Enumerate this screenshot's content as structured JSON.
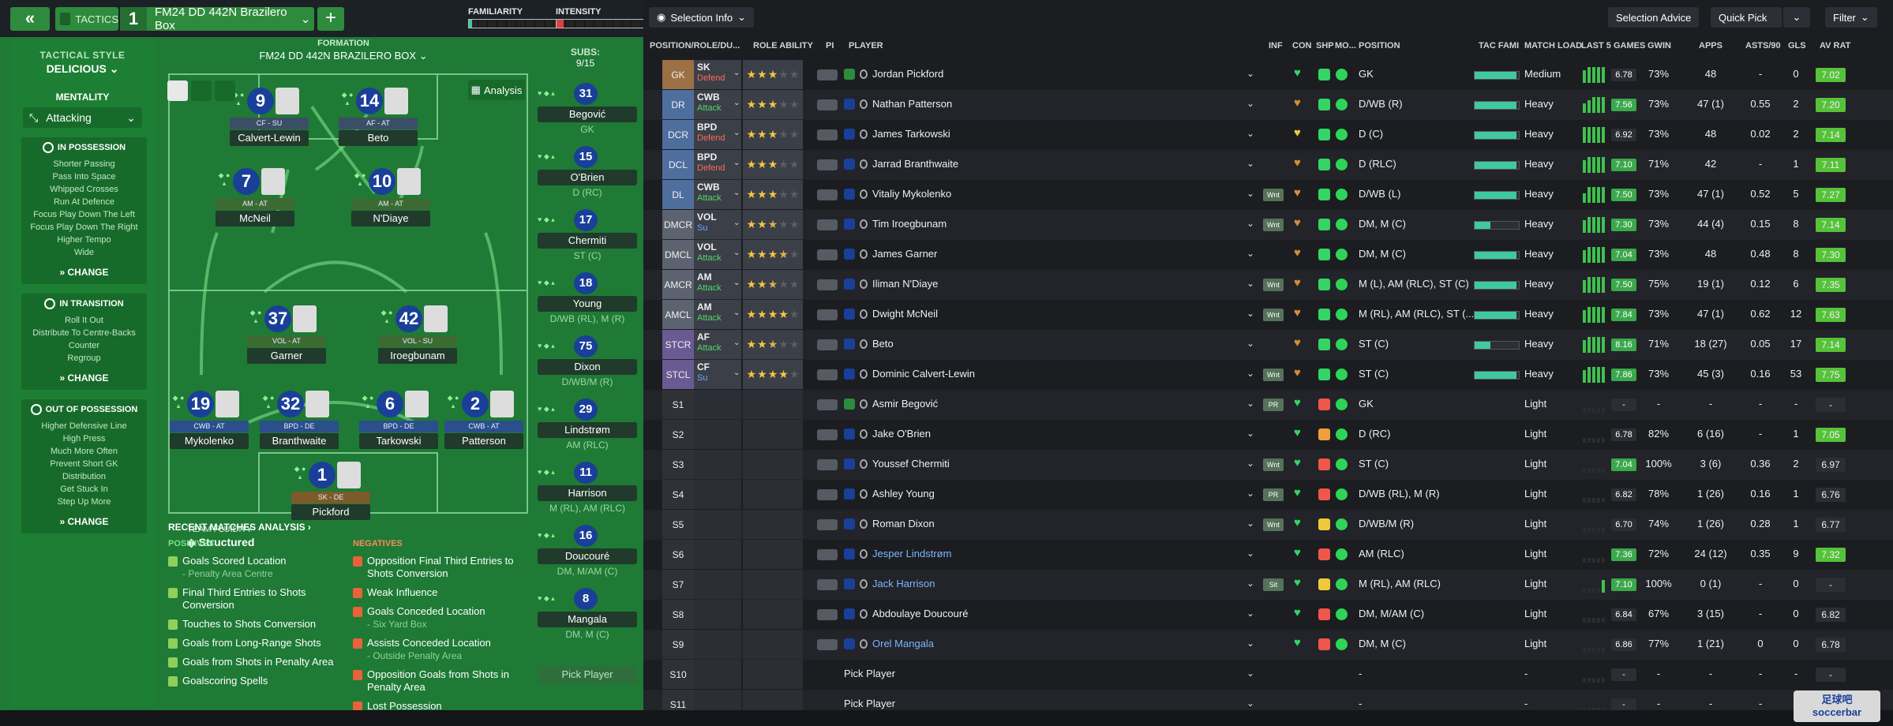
{
  "topbar": {
    "tactics_label": "TACTICS",
    "tactic_number": "1",
    "tactic_name": "FM24 DD 442N Brazilero Box",
    "add_label": "+",
    "familiarity_label": "FAMILIARITY",
    "familiarity_level": 0.03,
    "intensity_label": "INTENSITY",
    "intensity_level": 0.08
  },
  "side": {
    "tactical_style_label": "TACTICAL STYLE",
    "tactical_style_value": "DELICIOUS",
    "mentality_label": "MENTALITY",
    "mentality_value": "Attacking",
    "in_possession": {
      "title": "IN POSSESSION",
      "items": [
        "Shorter Passing",
        "Pass Into Space",
        "Whipped Crosses",
        "Run At Defence",
        "Focus Play Down The Left",
        "Focus Play Down The Right",
        "Higher Tempo",
        "Wide"
      ],
      "change": "CHANGE"
    },
    "in_transition": {
      "title": "IN TRANSITION",
      "items": [
        "Roll It Out",
        "Distribute To Centre-Backs",
        "Counter",
        "Regroup"
      ],
      "change": "CHANGE"
    },
    "out_of_possession": {
      "title": "OUT OF POSSESSION",
      "items": [
        "Higher Defensive Line",
        "High Press",
        "Much More Often",
        "Prevent Short GK",
        "Distribution",
        "Get Stuck In",
        "Step Up More"
      ],
      "change": "CHANGE"
    }
  },
  "pitch": {
    "formation_label": "FORMATION",
    "formation_name": "FM24 DD 442N BRAZILERO BOX",
    "analysis_label": "Analysis",
    "team_fluidity_label": "TEAM FLUIDITY",
    "team_fluidity_value": "Structured",
    "players": [
      {
        "num": "9",
        "role": "CF - SU",
        "name": "Calvert-Lewin",
        "cls": ""
      },
      {
        "num": "14",
        "role": "AF - AT",
        "name": "Beto",
        "cls": ""
      },
      {
        "num": "7",
        "role": "AM - AT",
        "name": "McNeil",
        "cls": "mf"
      },
      {
        "num": "10",
        "role": "AM - AT",
        "name": "N'Diaye",
        "cls": "mf"
      },
      {
        "num": "37",
        "role": "VOL - AT",
        "name": "Garner",
        "cls": "mf"
      },
      {
        "num": "42",
        "role": "VOL - SU",
        "name": "Iroegbunam",
        "cls": "mf"
      },
      {
        "num": "19",
        "role": "CWB - AT",
        "name": "Mykolenko",
        "cls": "de"
      },
      {
        "num": "32",
        "role": "BPD - DE",
        "name": "Branthwaite",
        "cls": "de"
      },
      {
        "num": "6",
        "role": "BPD - DE",
        "name": "Tarkowski",
        "cls": "de"
      },
      {
        "num": "2",
        "role": "CWB - AT",
        "name": "Patterson",
        "cls": "de"
      },
      {
        "num": "1",
        "role": "SK - DE",
        "name": "Pickford",
        "cls": "gk"
      }
    ]
  },
  "analysis": {
    "title": "RECENT MATCHES ANALYSIS",
    "positives_label": "POSITIVES",
    "negatives_label": "NEGATIVES",
    "positives": [
      {
        "t": "Goals Scored Location",
        "s": "- Penalty Area Centre"
      },
      {
        "t": "Final Third Entries to Shots Conversion",
        "s": ""
      },
      {
        "t": "Touches to Shots Conversion",
        "s": ""
      },
      {
        "t": "Goals from Long-Range Shots",
        "s": ""
      },
      {
        "t": "Goals from Shots in Penalty Area",
        "s": ""
      },
      {
        "t": "Goalscoring Spells",
        "s": ""
      }
    ],
    "negatives": [
      {
        "t": "Opposition Final Third Entries to Shots Conversion",
        "s": ""
      },
      {
        "t": "Weak Influence",
        "s": ""
      },
      {
        "t": "Goals Conceded Location",
        "s": "- Six Yard Box"
      },
      {
        "t": "Assists Conceded Location",
        "s": "- Outside Penalty Area"
      },
      {
        "t": "Opposition Goals from Shots in Penalty Area",
        "s": ""
      },
      {
        "t": "Lost Possession",
        "s": ""
      }
    ]
  },
  "subs": {
    "label": "SUBS:",
    "count": "9/15",
    "pick_label": "Pick Player",
    "items": [
      {
        "num": "31",
        "name": "Begović",
        "pos": "GK"
      },
      {
        "num": "15",
        "name": "O'Brien",
        "pos": "D (RC)"
      },
      {
        "num": "17",
        "name": "Chermiti",
        "pos": "ST (C)"
      },
      {
        "num": "18",
        "name": "Young",
        "pos": "D/WB (RL), M (R)"
      },
      {
        "num": "75",
        "name": "Dixon",
        "pos": "D/WB/M (R)"
      },
      {
        "num": "29",
        "name": "Lindstrøm",
        "pos": "AM (RLC)"
      },
      {
        "num": "11",
        "name": "Harrison",
        "pos": "M (RL), AM (RLC)"
      },
      {
        "num": "16",
        "name": "Doucouré",
        "pos": "DM, M/AM (C)"
      },
      {
        "num": "8",
        "name": "Mangala",
        "pos": "DM, M (C)"
      }
    ]
  },
  "toolbar": {
    "selection_info": "Selection Info",
    "selection_advice": "Selection Advice",
    "quick_pick": "Quick Pick",
    "filter": "Filter"
  },
  "columns": {
    "pos_role": "POSITION/ROLE/DU...",
    "role_ability": "ROLE ABILITY",
    "pi": "PI",
    "player": "PLAYER",
    "inf": "INF",
    "con": "CON",
    "shp": "SHP",
    "mo": "MO...",
    "position": "POSITION",
    "tac_fami": "TAC FAMI",
    "match_load": "MATCH LOAD",
    "last5": "LAST 5 GAMES",
    "gwin": "GWIN",
    "apps": "APPS",
    "asts90": "ASTS/90",
    "gls": "GLS",
    "av_rat": "AV RAT"
  },
  "rows": [
    {
      "slot": "GK",
      "sc": "gk",
      "role": "SK",
      "duty": "Defend",
      "dc": "d-defend",
      "stars": 3,
      "pname": "Jordan Pickford",
      "ic": "g",
      "inf": "",
      "con": "#35d466",
      "shp": "#35d466",
      "pos": "GK",
      "fam": 0.95,
      "load": "Medium",
      "bars": [
        4,
        5,
        5,
        5,
        5
      ],
      "rt": "6.78",
      "rtc": "#2b2e34",
      "gwin": "73%",
      "apps": "48",
      "asts": "-",
      "gls": "0",
      "avr": "7.02",
      "avc": "#56c23a"
    },
    {
      "slot": "DR",
      "sc": "def",
      "role": "CWB",
      "duty": "Attack",
      "dc": "d-attack",
      "stars": 3,
      "pname": "Nathan Patterson",
      "ic": "",
      "inf": "",
      "con": "#d98b3c",
      "shp": "#35d466",
      "pos": "D/WB (R)",
      "fam": 0.95,
      "load": "Heavy",
      "bars": [
        3,
        4,
        5,
        5,
        5
      ],
      "rt": "7.56",
      "rtc": "#3ba84b",
      "gwin": "73%",
      "apps": "47 (1)",
      "asts": "0.55",
      "gls": "2",
      "avr": "7.20",
      "avc": "#56c23a"
    },
    {
      "slot": "DCR",
      "sc": "def",
      "role": "BPD",
      "duty": "Defend",
      "dc": "d-defend",
      "stars": 3,
      "pname": "James Tarkowski",
      "ic": "",
      "inf": "",
      "con": "#f0c93a",
      "shp": "#35d466",
      "pos": "D (C)",
      "fam": 0.95,
      "load": "Heavy",
      "bars": [
        5,
        5,
        5,
        5,
        5
      ],
      "rt": "6.92",
      "rtc": "#2b2e34",
      "gwin": "73%",
      "apps": "48",
      "asts": "0.02",
      "gls": "2",
      "avr": "7.14",
      "avc": "#56c23a"
    },
    {
      "slot": "DCL",
      "sc": "def",
      "role": "BPD",
      "duty": "Defend",
      "dc": "d-defend",
      "stars": 3,
      "pname": "Jarrad Branthwaite",
      "ic": "",
      "inf": "",
      "con": "#d98b3c",
      "shp": "#35d466",
      "pos": "D (RLC)",
      "fam": 0.95,
      "load": "Heavy",
      "bars": [
        4,
        5,
        5,
        5,
        5
      ],
      "rt": "7.10",
      "rtc": "#3ba84b",
      "gwin": "71%",
      "apps": "42",
      "asts": "-",
      "gls": "1",
      "avr": "7.11",
      "avc": "#56c23a"
    },
    {
      "slot": "DL",
      "sc": "def",
      "role": "CWB",
      "duty": "Attack",
      "dc": "d-attack",
      "stars": 3,
      "pname": "Vitaliy Mykolenko",
      "ic": "",
      "inf": "Wnt",
      "con": "#d98b3c",
      "shp": "#35d466",
      "pos": "D/WB (L)",
      "fam": 0.95,
      "load": "Heavy",
      "bars": [
        3,
        5,
        5,
        5,
        5
      ],
      "rt": "7.50",
      "rtc": "#3ba84b",
      "gwin": "73%",
      "apps": "47 (1)",
      "asts": "0.52",
      "gls": "5",
      "avr": "7.27",
      "avc": "#56c23a"
    },
    {
      "slot": "DMCR",
      "sc": "mid",
      "role": "VOL",
      "duty": "Su",
      "dc": "d-support",
      "stars": 2.5,
      "pname": "Tim Iroegbunam",
      "ic": "",
      "inf": "Wnt",
      "con": "#d98b3c",
      "shp": "#35d466",
      "pos": "DM, M (C)",
      "fam": 0.35,
      "load": "Heavy",
      "bars": [
        4,
        5,
        5,
        5,
        5
      ],
      "rt": "7.30",
      "rtc": "#3ba84b",
      "gwin": "73%",
      "apps": "44 (4)",
      "asts": "0.15",
      "gls": "8",
      "avr": "7.14",
      "avc": "#56c23a"
    },
    {
      "slot": "DMCL",
      "sc": "mid",
      "role": "VOL",
      "duty": "Attack",
      "dc": "d-attack",
      "stars": 3.5,
      "pname": "James Garner",
      "ic": "",
      "inf": "",
      "con": "#d98b3c",
      "shp": "#35d466",
      "pos": "DM, M (C)",
      "fam": 0.95,
      "load": "Heavy",
      "bars": [
        4,
        5,
        5,
        5,
        5
      ],
      "rt": "7.04",
      "rtc": "#3ba84b",
      "gwin": "73%",
      "apps": "48",
      "asts": "0.48",
      "gls": "8",
      "avr": "7.30",
      "avc": "#56c23a"
    },
    {
      "slot": "AMCR",
      "sc": "mid",
      "role": "AM",
      "duty": "Attack",
      "dc": "d-attack",
      "stars": 2.5,
      "pname": "Iliman N'Diaye",
      "ic": "",
      "inf": "Wnt",
      "con": "#d98b3c",
      "shp": "#35d466",
      "pos": "M (L), AM (RLC), ST (C)",
      "fam": 0.95,
      "load": "Heavy",
      "bars": [
        4,
        5,
        5,
        5,
        5
      ],
      "rt": "7.50",
      "rtc": "#3ba84b",
      "gwin": "75%",
      "apps": "19 (1)",
      "asts": "0.12",
      "gls": "6",
      "avr": "7.35",
      "avc": "#56c23a"
    },
    {
      "slot": "AMCL",
      "sc": "mid",
      "role": "AM",
      "duty": "Attack",
      "dc": "d-attack",
      "stars": 4,
      "pname": "Dwight McNeil",
      "ic": "",
      "inf": "Wnt",
      "con": "#d98b3c",
      "shp": "#35d466",
      "pos": "M (RL), AM (RLC), ST (...",
      "fam": 0.95,
      "load": "Heavy",
      "bars": [
        4,
        5,
        5,
        5,
        5
      ],
      "rt": "7.84",
      "rtc": "#3ba84b",
      "gwin": "73%",
      "apps": "47 (1)",
      "asts": "0.62",
      "gls": "12",
      "avr": "7.63",
      "avc": "#56c23a"
    },
    {
      "slot": "STCR",
      "sc": "str",
      "role": "AF",
      "duty": "Attack",
      "dc": "d-attack",
      "stars": 2.5,
      "pname": "Beto",
      "ic": "",
      "inf": "",
      "con": "#d98b3c",
      "shp": "#35d466",
      "pos": "ST (C)",
      "fam": 0.35,
      "load": "Heavy",
      "bars": [
        4,
        5,
        5,
        5,
        5
      ],
      "rt": "8.16",
      "rtc": "#3ba84b",
      "gwin": "71%",
      "apps": "18 (27)",
      "asts": "0.05",
      "gls": "17",
      "avr": "7.14",
      "avc": "#56c23a"
    },
    {
      "slot": "STCL",
      "sc": "str",
      "role": "CF",
      "duty": "Su",
      "dc": "d-support",
      "stars": 4,
      "pname": "Dominic Calvert-Lewin",
      "ic": "",
      "inf": "Wnt",
      "con": "#d98b3c",
      "shp": "#35d466",
      "pos": "ST (C)",
      "fam": 0.95,
      "load": "Heavy",
      "bars": [
        4,
        5,
        5,
        5,
        5
      ],
      "rt": "7.86",
      "rtc": "#3ba84b",
      "gwin": "73%",
      "apps": "45 (3)",
      "asts": "0.16",
      "gls": "53",
      "avr": "7.75",
      "avc": "#56c23a"
    },
    {
      "slot": "S1",
      "sc": "sub",
      "role": "",
      "duty": "",
      "dc": "",
      "stars": 0,
      "pname": "Asmir Begović",
      "ic": "g",
      "inf": "PR",
      "con": "#35d466",
      "shp": "#f0574a",
      "pos": "GK",
      "fam": 0,
      "load": "Light",
      "bars": [
        0,
        0,
        0,
        0,
        0
      ],
      "rt": "-",
      "rtc": "#2b2e34",
      "gwin": "-",
      "apps": "-",
      "asts": "-",
      "gls": "-",
      "avr": "-",
      "avc": "#2b2e34"
    },
    {
      "slot": "S2",
      "sc": "sub",
      "role": "",
      "duty": "",
      "dc": "",
      "stars": 0,
      "pname": "Jake O'Brien",
      "ic": "",
      "inf": "",
      "con": "#35d466",
      "shp": "#f0a03a",
      "pos": "D (RC)",
      "fam": 0,
      "load": "Light",
      "bars": [
        0,
        0,
        0,
        0,
        0
      ],
      "rt": "6.78",
      "rtc": "#2b2e34",
      "gwin": "82%",
      "apps": "6 (16)",
      "asts": "-",
      "gls": "1",
      "avr": "7.05",
      "avc": "#56c23a"
    },
    {
      "slot": "S3",
      "sc": "sub",
      "role": "",
      "duty": "",
      "dc": "",
      "stars": 0,
      "pname": "Youssef Chermiti",
      "ic": "",
      "inf": "Wnt",
      "con": "#35d466",
      "shp": "#f0574a",
      "pos": "ST (C)",
      "fam": 0,
      "load": "Light",
      "bars": [
        0,
        0,
        0,
        0,
        0
      ],
      "rt": "7.04",
      "rtc": "#3ba84b",
      "gwin": "100%",
      "apps": "3 (6)",
      "asts": "0.36",
      "gls": "2",
      "avr": "6.97",
      "avc": "#2b2e34"
    },
    {
      "slot": "S4",
      "sc": "sub",
      "role": "",
      "duty": "",
      "dc": "",
      "stars": 0,
      "pname": "Ashley Young",
      "ic": "",
      "inf": "PR",
      "con": "#35d466",
      "shp": "#f0574a",
      "pos": "D/WB (RL), M (R)",
      "fam": 0,
      "load": "Light",
      "bars": [
        0,
        0,
        0,
        0,
        0
      ],
      "rt": "6.82",
      "rtc": "#2b2e34",
      "gwin": "78%",
      "apps": "1 (26)",
      "asts": "0.16",
      "gls": "1",
      "avr": "6.76",
      "avc": "#2b2e34"
    },
    {
      "slot": "S5",
      "sc": "sub",
      "role": "",
      "duty": "",
      "dc": "",
      "stars": 0,
      "pname": "Roman Dixon",
      "ic": "",
      "inf": "Wnt",
      "con": "#35d466",
      "shp": "#f0c93a",
      "pos": "D/WB/M (R)",
      "fam": 0,
      "load": "Light",
      "bars": [
        0,
        0,
        0,
        0,
        0
      ],
      "rt": "6.70",
      "rtc": "#2b2e34",
      "gwin": "74%",
      "apps": "1 (26)",
      "asts": "0.28",
      "gls": "1",
      "avr": "6.77",
      "avc": "#2b2e34"
    },
    {
      "slot": "S6",
      "sc": "sub",
      "role": "",
      "duty": "",
      "dc": "",
      "stars": 0,
      "pname": "Jesper Lindstrøm",
      "ic": "",
      "inf": "",
      "con": "#35d466",
      "shp": "#f0574a",
      "pos": "AM (RLC)",
      "fam": 0,
      "load": "Light",
      "bars": [
        0,
        0,
        0,
        0,
        0
      ],
      "rt": "7.36",
      "rtc": "#3ba84b",
      "gwin": "72%",
      "apps": "24 (12)",
      "asts": "0.35",
      "gls": "9",
      "avr": "7.32",
      "avc": "#56c23a",
      "blue": true
    },
    {
      "slot": "S7",
      "sc": "sub",
      "role": "",
      "duty": "",
      "dc": "",
      "stars": 0,
      "pname": "Jack Harrison",
      "ic": "",
      "inf": "Sit",
      "con": "#35d466",
      "shp": "#f0c93a",
      "pos": "M (RL), AM (RLC)",
      "fam": 0,
      "load": "Light",
      "bars": [
        0,
        0,
        0,
        0,
        4
      ],
      "rt": "7.10",
      "rtc": "#3ba84b",
      "gwin": "100%",
      "apps": "0 (1)",
      "asts": "-",
      "gls": "0",
      "avr": "-",
      "avc": "#2b2e34",
      "blue": true
    },
    {
      "slot": "S8",
      "sc": "sub",
      "role": "",
      "duty": "",
      "dc": "",
      "stars": 0,
      "pname": "Abdoulaye Doucouré",
      "ic": "",
      "inf": "",
      "con": "#35d466",
      "shp": "#f0574a",
      "pos": "DM, M/AM (C)",
      "fam": 0,
      "load": "Light",
      "bars": [
        0,
        0,
        0,
        0,
        0
      ],
      "rt": "6.84",
      "rtc": "#2b2e34",
      "gwin": "67%",
      "apps": "3 (15)",
      "asts": "-",
      "gls": "0",
      "avr": "6.82",
      "avc": "#2b2e34"
    },
    {
      "slot": "S9",
      "sc": "sub",
      "role": "",
      "duty": "",
      "dc": "",
      "stars": 0,
      "pname": "Orel Mangala",
      "ic": "",
      "inf": "",
      "con": "#35d466",
      "shp": "#f0574a",
      "pos": "DM, M (C)",
      "fam": 0,
      "load": "Light",
      "bars": [
        0,
        0,
        0,
        0,
        0
      ],
      "rt": "6.86",
      "rtc": "#2b2e34",
      "gwin": "77%",
      "apps": "1 (21)",
      "asts": "0",
      "gls": "0",
      "avr": "6.78",
      "avc": "#2b2e34",
      "blue": true
    },
    {
      "slot": "S10",
      "sc": "sub",
      "role": "",
      "duty": "",
      "dc": "",
      "stars": 0,
      "pname": "Pick Player",
      "ic": "none",
      "inf": "",
      "con": "",
      "shp": "",
      "pos": "-",
      "fam": 0,
      "load": "-",
      "bars": [
        0,
        0,
        0,
        0,
        0
      ],
      "rt": "-",
      "rtc": "#2b2e34",
      "gwin": "-",
      "apps": "-",
      "asts": "-",
      "gls": "-",
      "avr": "-",
      "avc": "#2b2e34"
    },
    {
      "slot": "S11",
      "sc": "sub",
      "role": "",
      "duty": "",
      "dc": "",
      "stars": 0,
      "pname": "Pick Player",
      "ic": "none",
      "inf": "",
      "con": "",
      "shp": "",
      "pos": "-",
      "fam": 0,
      "load": "-",
      "bars": [
        0,
        0,
        0,
        0,
        0
      ],
      "rt": "-",
      "rtc": "#2b2e34",
      "gwin": "-",
      "apps": "-",
      "asts": "-",
      "gls": "-",
      "avr": "-",
      "avc": "#2b2e34"
    }
  ],
  "watermark": {
    "line1": "足球吧",
    "line2": "soccerbar"
  }
}
